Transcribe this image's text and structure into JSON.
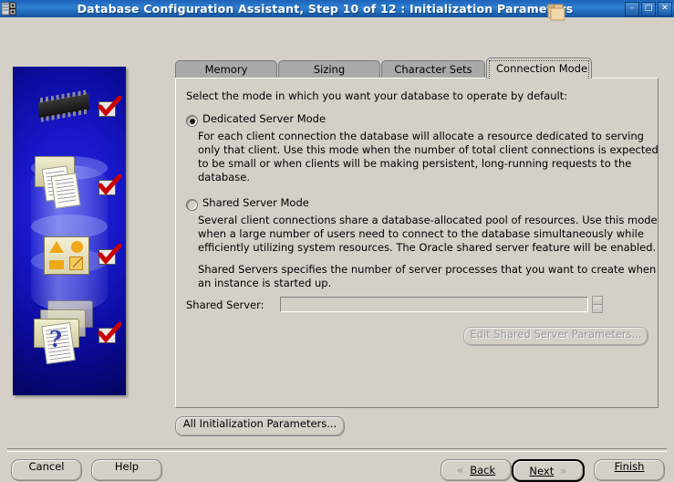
{
  "window": {
    "title": "Database Configuration Assistant, Step 10 of 12 : Initialization Parameters",
    "icon": "database-assistant-icon",
    "minimize_label": "–",
    "maximize_label": "□",
    "close_label": "✕"
  },
  "tabs": [
    {
      "label": "Memory",
      "active": false
    },
    {
      "label": "Sizing",
      "active": false
    },
    {
      "label": "Character Sets",
      "active": false
    },
    {
      "label": "Connection Mode",
      "active": true
    }
  ],
  "content": {
    "intro": "Select the mode in which you want your database to operate by default:",
    "dedicated": {
      "label": "Dedicated Server Mode",
      "selected": true,
      "description": "For each client connection the database will allocate a resource dedicated to serving only that client.  Use this mode when the number of total client connections is expected to be small or when clients will be making persistent, long-running requests to the database."
    },
    "shared": {
      "label": "Shared Server Mode",
      "selected": false,
      "description": "Several client connections share a database-allocated pool of resources.  Use this mode when a large number of users need to connect to the database simultaneously while efficiently utilizing system resources.  The Oracle shared server feature will be enabled.",
      "note": "Shared Servers specifies the number of server processes that you want to create when an instance is started up.",
      "field_label": "Shared Server:",
      "field_value": "",
      "field_placeholder": "",
      "field_enabled": false,
      "edit_button": "Edit Shared Server Parameters...",
      "edit_button_enabled": false
    },
    "all_parameters_button": "All Initialization Parameters..."
  },
  "footer": {
    "cancel": "Cancel",
    "help": "Help",
    "back": "Back",
    "back_icon": "chevron-left-icon",
    "next": "Next",
    "next_icon": "chevron-right-icon",
    "finish": "Finish"
  },
  "banner": {
    "alt": "database configuration artwork",
    "checkmark_count": 4
  },
  "colors": {
    "titlebar": "#2472c4",
    "face": "#d4d0c8",
    "tab_inactive": "#a9a9a9",
    "banner_blue": "#1717c8",
    "check_red": "#cc0000"
  }
}
